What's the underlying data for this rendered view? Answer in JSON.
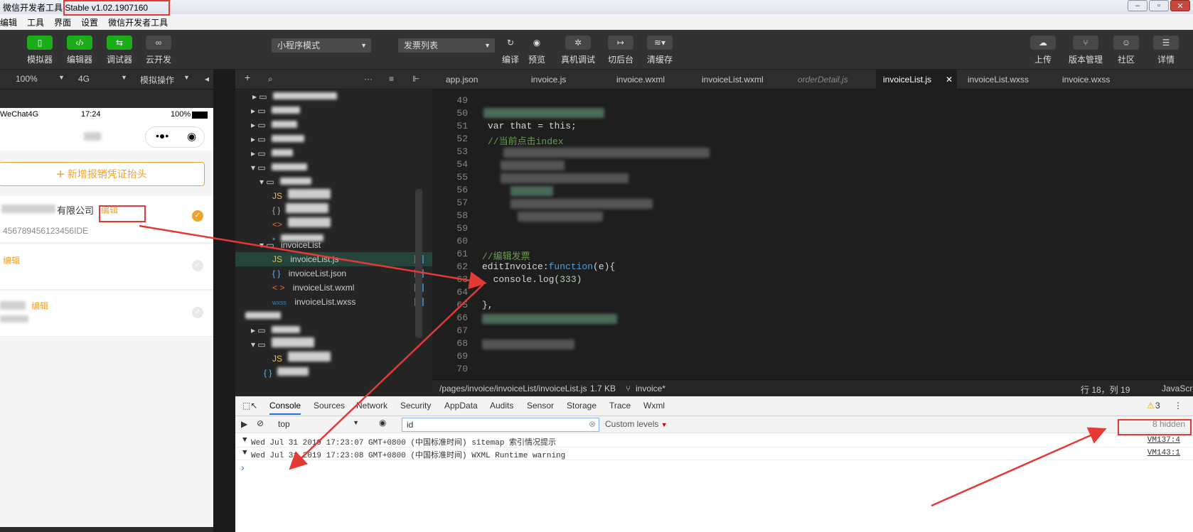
{
  "window": {
    "title": "微信开发者工具 Stable v1.02.1907160"
  },
  "menubar": [
    "编辑",
    "工具",
    "界面",
    "设置",
    "微信开发者工具"
  ],
  "toolbar": {
    "left_buttons": [
      {
        "label": "模拟器",
        "icon": "phone-icon"
      },
      {
        "label": "编辑器",
        "icon": "code-icon"
      },
      {
        "label": "调试器",
        "icon": "debug-icon"
      },
      {
        "label": "云开发",
        "icon": "cloud-link-icon"
      }
    ],
    "mode_select": "小程序模式",
    "page_select": "发票列表",
    "mid_buttons": [
      {
        "label": "编译",
        "icon": "refresh-icon"
      },
      {
        "label": "预览",
        "icon": "eye-icon"
      },
      {
        "label": "真机调试",
        "icon": "bug-icon"
      },
      {
        "label": "切后台",
        "icon": "switch-icon"
      },
      {
        "label": "清缓存",
        "icon": "layers-icon"
      }
    ],
    "right_buttons": [
      {
        "label": "上传",
        "icon": "upload-icon"
      },
      {
        "label": "版本管理",
        "icon": "branch-icon"
      },
      {
        "label": "社区",
        "icon": "chat-icon"
      },
      {
        "label": "详情",
        "icon": "menu-icon"
      }
    ]
  },
  "simulator_bar": {
    "zoom": "100%",
    "network": "4G",
    "ops": "模拟操作"
  },
  "editor_tabs": [
    {
      "label": "app.json",
      "active": false,
      "italic": false
    },
    {
      "label": "invoice.js",
      "active": false,
      "italic": false
    },
    {
      "label": "invoice.wxml",
      "active": false,
      "italic": false
    },
    {
      "label": "invoiceList.wxml",
      "active": false,
      "italic": false
    },
    {
      "label": "orderDetail.js",
      "active": false,
      "italic": true
    },
    {
      "label": "invoiceList.js",
      "active": true,
      "italic": false
    },
    {
      "label": "invoiceList.wxss",
      "active": false,
      "italic": false
    },
    {
      "label": "invoice.wxss",
      "active": false,
      "italic": false
    }
  ],
  "phone": {
    "carrier": "WeChat4G",
    "time": "17:24",
    "battery": "100%",
    "add_button": "新增报销凭证抬头",
    "company_suffix": "有限公司",
    "edit_label": "编辑",
    "tax_id": "456789456123456IDE"
  },
  "explorer": {
    "folder": "invoiceList",
    "files": [
      {
        "name": "invoiceList.js",
        "type": "JS",
        "badge": "U"
      },
      {
        "name": "invoiceList.json",
        "type": "{ }",
        "badge": "U"
      },
      {
        "name": "invoiceList.wxml",
        "type": "< >",
        "badge": "U"
      },
      {
        "name": "invoiceList.wxss",
        "type": "wxss",
        "badge": "U"
      }
    ]
  },
  "code": {
    "line_numbers": [
      "49",
      "50",
      "51",
      "52",
      "53",
      "54",
      "55",
      "56",
      "57",
      "58",
      "59",
      "60",
      "61",
      "62",
      "63",
      "64",
      "65",
      "66",
      "67",
      "68",
      "69",
      "70"
    ],
    "l51": "var that = this;",
    "l52": "//当前点击index",
    "l61": "//编辑发票",
    "l62a": "editInvoice:",
    "l62b": "function",
    "l62c": "(e){",
    "l63a": "  console.log(",
    "l63b": "333",
    "l63c": ")",
    "l65": "},"
  },
  "editor_status": {
    "path": "/pages/invoice/invoiceList/invoiceList.js",
    "size": "1.7 KB",
    "branch": "invoice*",
    "position": "行 18，列 19",
    "lang": "JavaScri"
  },
  "devtools": {
    "tabs": [
      "Console",
      "Sources",
      "Network",
      "Security",
      "AppData",
      "Audits",
      "Sensor",
      "Storage",
      "Trace",
      "Wxml"
    ],
    "warnings": "3",
    "context": "top",
    "filter_value": "id",
    "levels": "Custom levels",
    "hidden": "8 hidden",
    "messages": [
      {
        "text": "Wed Jul 31 2019 17:23:07 GMT+0800 (中国标准时间) sitemap 索引情况提示",
        "src": "VM137:4"
      },
      {
        "text": "Wed Jul 31 2019 17:23:08 GMT+0800 (中国标准时间) WXML Runtime warning",
        "src": "VM143:1"
      }
    ],
    "prompt": "›"
  },
  "colors": {
    "accent": "#f0a32a",
    "annotation": "#e53935",
    "green": "#1aad19"
  }
}
